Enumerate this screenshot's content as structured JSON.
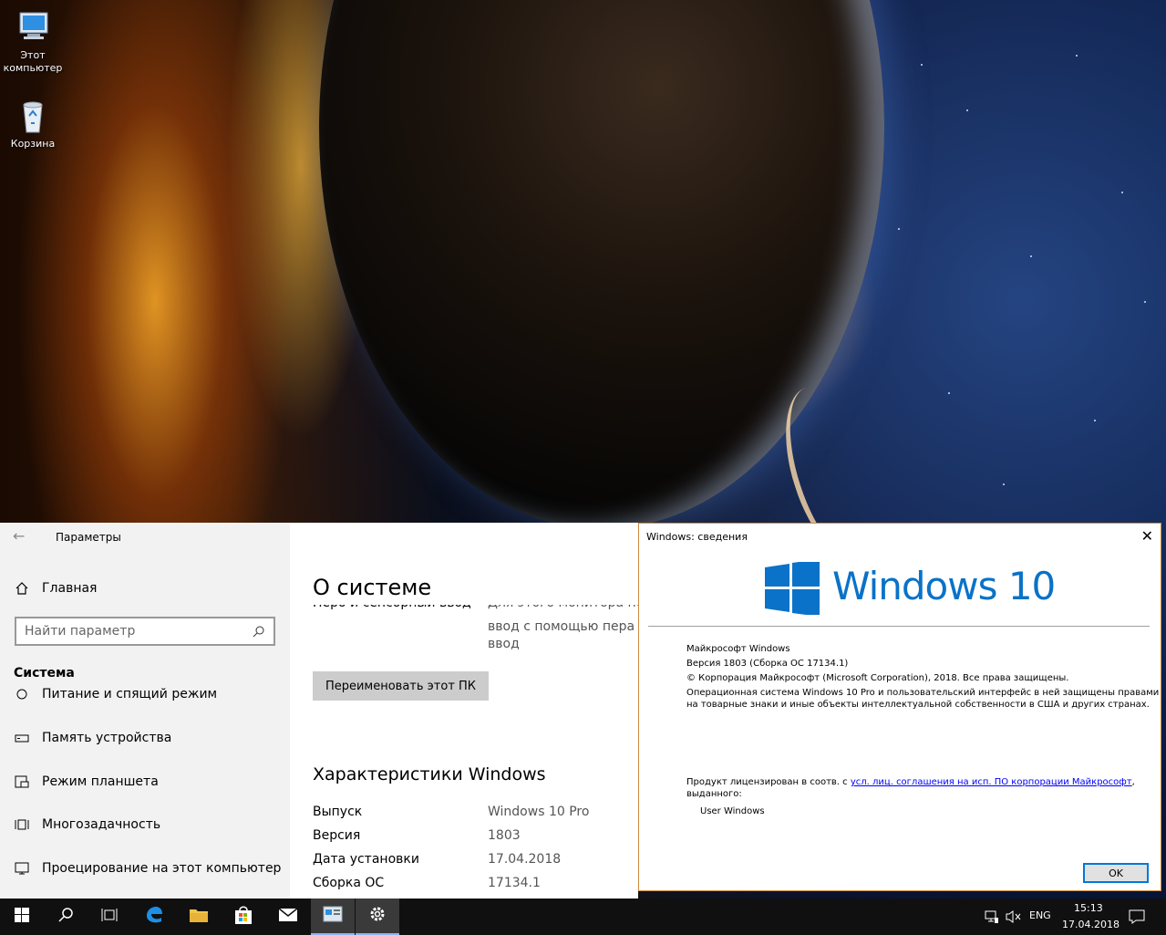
{
  "desktop": {
    "icons": [
      {
        "label_line1": "Этот",
        "label_line2": "компьютер"
      },
      {
        "label_line1": "Корзина",
        "label_line2": ""
      }
    ]
  },
  "settings": {
    "window_title": "Параметры",
    "home_label": "Главная",
    "search_placeholder": "Найти параметр",
    "section_label": "Система",
    "nav_items": [
      {
        "label": "Питание и спящий режим",
        "icon": "power-icon"
      },
      {
        "label": "Память устройства",
        "icon": "storage-icon"
      },
      {
        "label": "Режим планшета",
        "icon": "tablet-icon"
      },
      {
        "label": "Многозадачность",
        "icon": "multitasking-icon"
      },
      {
        "label": "Проецирование на этот компьютер",
        "icon": "projecting-icon"
      }
    ],
    "page_title": "О системе",
    "pen_label": "Перо и сенсорный ввод",
    "pen_value_line1": "Для этого монитора недо",
    "pen_value_line2": "ввод с помощью пера и",
    "pen_value_line3": "ввод",
    "rename_button": "Переименовать этот ПК",
    "spec_heading": "Характеристики Windows",
    "specs": [
      {
        "label": "Выпуск",
        "value": "Windows 10 Pro"
      },
      {
        "label": "Версия",
        "value": "1803"
      },
      {
        "label": "Дата установки",
        "value": "17.04.2018"
      },
      {
        "label": "Сборка ОС",
        "value": "17134.1"
      }
    ]
  },
  "about_dialog": {
    "title": "Windows: сведения",
    "logo_text": "Windows 10",
    "logo_color": "#0a72c8",
    "line_product": "Майкрософт Windows",
    "line_version": "Версия 1803 (Сборка ОС 17134.1)",
    "line_copyright": "© Корпорация Майкрософт (Microsoft Corporation), 2018. Все права защищены.",
    "line_desc1": "Операционная система Windows 10 Pro и пользовательский интерфейс в ней защищены правами",
    "line_desc2": "на товарные знаки и иные объекты интеллектуальной собственности в США и других странах.",
    "license_prefix": "Продукт лицензирован в соотв. с ",
    "license_link": "усл. лиц. соглашения на исп. ПО корпорации Майкрософт",
    "license_suffix": ",",
    "license_line2": "выданного:",
    "licensee": "User Windows",
    "ok_button": "OK"
  },
  "taskbar": {
    "language": "ENG",
    "time": "15:13",
    "date": "17.04.2018",
    "accent_color": "#8ab4f8"
  }
}
